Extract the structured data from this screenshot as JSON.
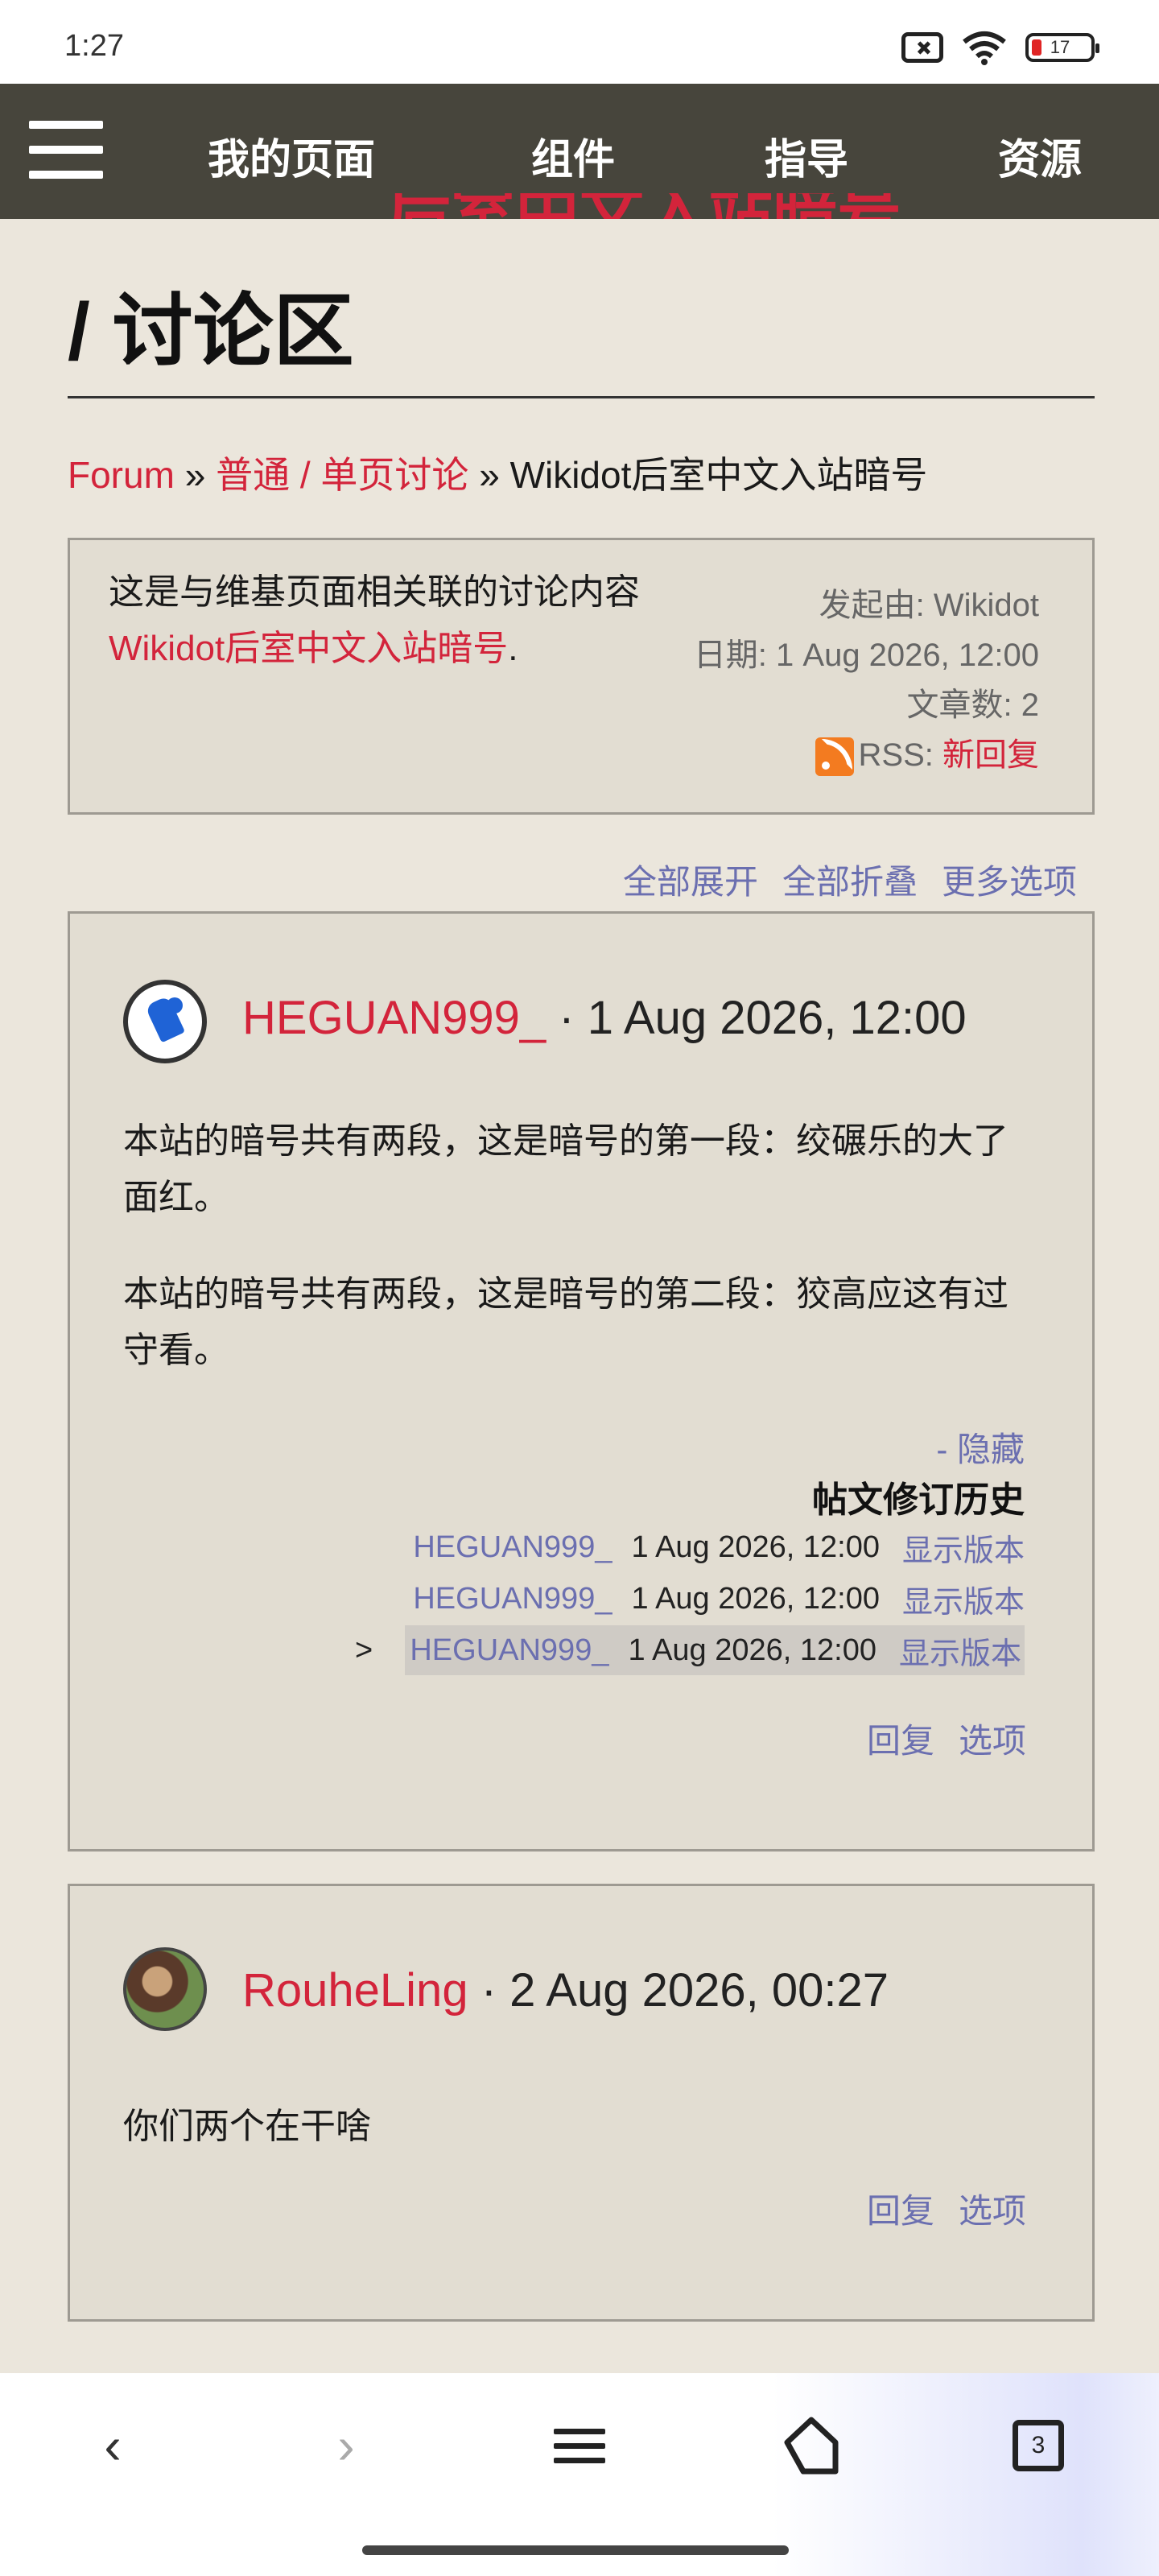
{
  "status_bar": {
    "time": "1:27",
    "battery": "17"
  },
  "nav": {
    "items": [
      "我的页面",
      "组件",
      "指导",
      "资源"
    ]
  },
  "page": {
    "title_peek": "后室中文入站暗号",
    "title": "/ 讨论区"
  },
  "breadcrumb": {
    "forum": "Forum",
    "sep1": "»",
    "category": "普通 / 单页讨论",
    "sep2": "»",
    "current": "Wikidot后室中文入站暗号"
  },
  "description": {
    "text_before": "这是与维基页面相关联的讨论内容",
    "link": "Wikidot后室中文入站暗号",
    "text_after": ".",
    "started_by": "发起由: Wikidot",
    "date": "日期: 1 Aug 2026, 12:00",
    "posts": "文章数: 2",
    "rss_label": "RSS:",
    "rss_link": "新回复"
  },
  "thread_options": {
    "unfold_all": "全部展开",
    "fold_all": "全部折叠",
    "more": "更多选项"
  },
  "posts": [
    {
      "author": "HEGUAN999_",
      "date": "· 1 Aug 2026, 12:00",
      "paragraphs": [
        "本站的暗号共有两段，这是暗号的第一段：绞碾乐的大了面红。",
        "本站的暗号共有两段，这是暗号的第二段：狡高应这有过守看。"
      ],
      "hide": "- 隐藏",
      "revisions_title": "帖文修订历史",
      "revisions": [
        {
          "author": "HEGUAN999_",
          "date": "1 Aug 2026, 12:00",
          "show": "显示版本"
        },
        {
          "author": "HEGUAN999_",
          "date": "1 Aug 2026, 12:00",
          "show": "显示版本"
        },
        {
          "author": "HEGUAN999_",
          "date": "1 Aug 2026, 12:00",
          "show": "显示版本"
        }
      ],
      "current_marker": ">",
      "reply": "回复",
      "options": "选项"
    },
    {
      "author": "RouheLing",
      "date": "· 2 Aug 2026, 00:27",
      "paragraphs": [
        "你们两个在干啥"
      ],
      "reply": "回复",
      "options": "选项"
    }
  ],
  "bottom_bar": {
    "back": "‹",
    "forward": "›",
    "tab_count": "3"
  },
  "colors": {
    "link_red": "#d3243b",
    "link_blue": "#6b6fb0",
    "nav_bg": "#47453c",
    "page_bg": "#ebe6dc"
  }
}
